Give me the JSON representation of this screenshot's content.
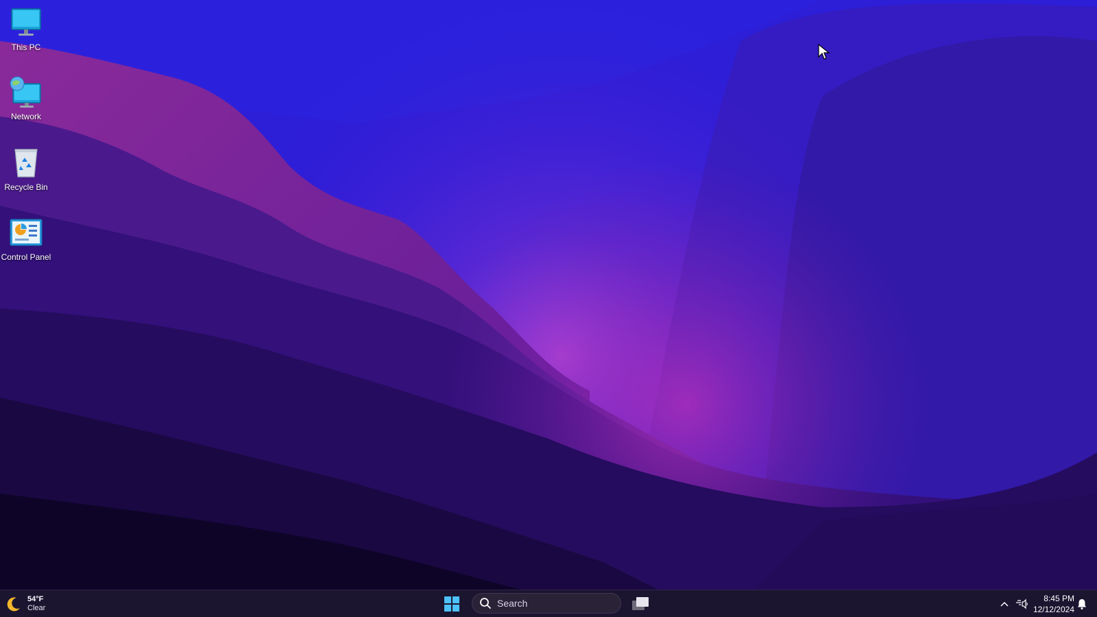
{
  "desktop": {
    "icons": [
      {
        "label": "This PC",
        "icon": "monitor-icon"
      },
      {
        "label": "Network",
        "icon": "network-globe-icon"
      },
      {
        "label": "Recycle Bin",
        "icon": "recycle-bin-icon"
      },
      {
        "label": "Control Panel",
        "icon": "control-panel-icon"
      }
    ]
  },
  "taskbar": {
    "weather": {
      "temperature": "54°F",
      "condition": "Clear",
      "icon": "moon-icon"
    },
    "start_icon": "windows-logo-icon",
    "search": {
      "label": "Search",
      "icon": "search-icon"
    },
    "taskview_icon": "task-view-icon",
    "tray": {
      "chevron_icon": "chevron-up-icon",
      "network_icon": "network-volume-icon",
      "time": "8:45 PM",
      "date": "12/12/2024",
      "notification_icon": "bell-icon"
    }
  },
  "colors": {
    "taskbar_bg": "#1b1530",
    "wallpaper_top": "#2a1cd6",
    "wallpaper_glow": "#b03fd8",
    "accent_windows": "#4cc2ff"
  }
}
